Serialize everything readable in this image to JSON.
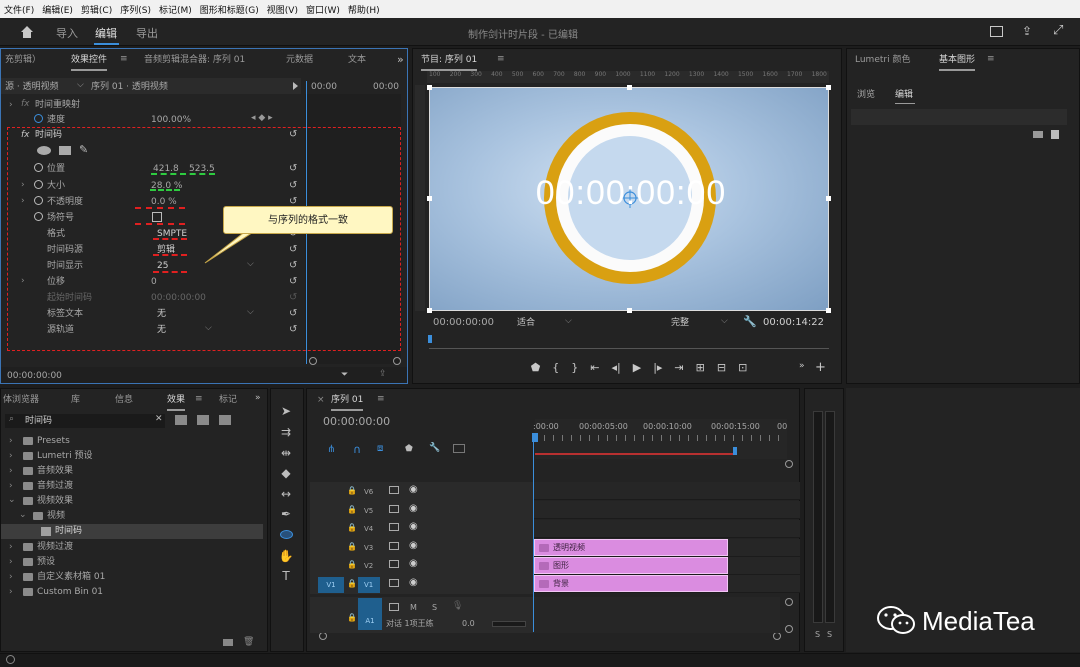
{
  "menu": [
    "文件(F)",
    "编辑(E)",
    "剪辑(C)",
    "序列(S)",
    "标记(M)",
    "图形和标题(G)",
    "视图(V)",
    "窗口(W)",
    "帮助(H)"
  ],
  "workspace": {
    "import": "导入",
    "edit": "编辑",
    "export": "导出",
    "title": "制作剑计时片段 - 已编辑"
  },
  "effect_panel": {
    "tab_left": "充剪辑）",
    "tab_active": "效果控件",
    "tab_mixer": "音频剪辑混合器: 序列 01",
    "tab_meta": "元数据",
    "tab_text": "文本",
    "source": "源 · 透明视频",
    "seq": "序列 01 · 透明视频",
    "time_a": "00:00",
    "time_b": "00:00",
    "timeremap": "时间重映射",
    "speed_label": "速度",
    "speed_val": "100.00%",
    "effect_name": "时间码",
    "pos_label": "位置",
    "pos_x": "421.8",
    "pos_y": "523.5",
    "size_label": "大小",
    "size_val": "28.0 %",
    "opacity_label": "不透明度",
    "opacity_val": "0.0 %",
    "field_label": "场符号",
    "format_label": "格式",
    "format_val": "SMPTE",
    "source_label": "时间码源",
    "source_val": "剪辑",
    "display_label": "时间显示",
    "display_val": "25",
    "offset_label": "位移",
    "offset_val": "0",
    "start_label": "起始时间码",
    "start_val": "00:00:00:00",
    "label_text": "标签文本",
    "label_val": "无",
    "src_track": "源轨道",
    "src_track_val": "无",
    "callout": "与序列的格式一致",
    "bottom_time": "00:00:00:00"
  },
  "program": {
    "title": "节目: 序列 01",
    "ruler": [
      "100",
      "200",
      "300",
      "400",
      "500",
      "600",
      "700",
      "800",
      "900",
      "1000",
      "1100",
      "1200",
      "1300",
      "1400",
      "1500",
      "1600",
      "1700",
      "1800"
    ],
    "timecode": "00:00:00:00",
    "left_time": "00:00:00:00",
    "fit": "适合",
    "quality": "完整",
    "duration": "00:00:14:22"
  },
  "right_panel": {
    "tab_lumetri": "Lumetri 颜色",
    "tab_graphics": "基本图形",
    "sub_browse": "浏览",
    "sub_edit": "编辑"
  },
  "effects_browser": {
    "tab_browser": "体浏览器",
    "tab_lib": "库",
    "tab_info": "信息",
    "tab_effects": "效果",
    "tab_markers": "标记",
    "search": "时间码",
    "tree": [
      "Presets",
      "Lumetri 预设",
      "音频效果",
      "音频过渡",
      "视频效果",
      "视频",
      "时间码",
      "视频过渡",
      "预设",
      "自定义素材箱 01",
      "Custom Bin 01"
    ]
  },
  "timeline": {
    "tab": "序列 01",
    "timecode": "00:00:00:00",
    "ruler": [
      ":00:00",
      "00:00:05:00",
      "00:00:10:00",
      "00:00:15:00",
      "00"
    ],
    "tracks": [
      "V6",
      "V5",
      "V4",
      "V3",
      "V2",
      "V1"
    ],
    "audio_label": "A1",
    "audio_name": "对话 1项王练",
    "audio_vol": "0.0",
    "m": "M",
    "s": "S",
    "clips": [
      "透明视频",
      "图形",
      "背景"
    ]
  },
  "watermark": "MediaTea",
  "meter": [
    "S",
    "S"
  ]
}
